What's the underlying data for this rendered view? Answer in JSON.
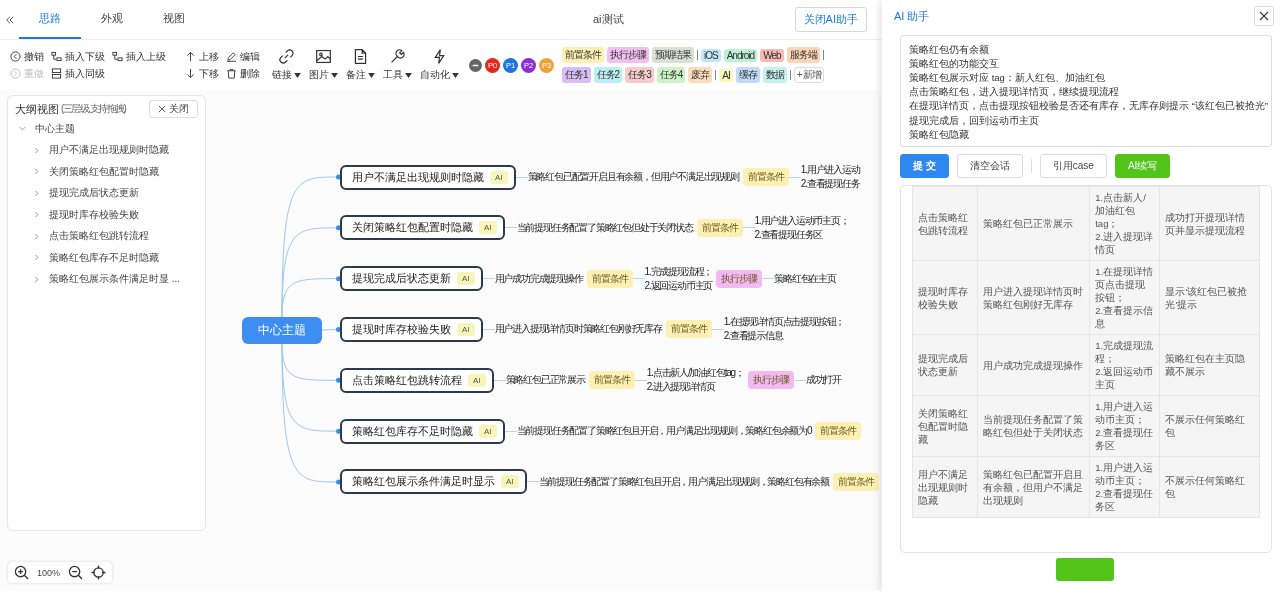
{
  "header": {
    "tabs": [
      {
        "label": "思路",
        "selected": true
      },
      {
        "label": "外观",
        "selected": false
      },
      {
        "label": "视图",
        "selected": false
      }
    ],
    "title": "ai测试",
    "toggle_button": "关闭AI助手"
  },
  "toolbar": {
    "edit_columns": [
      [
        {
          "label": "撤销",
          "kind": "undo",
          "disabled": false
        },
        {
          "label": "重做",
          "kind": "redo",
          "disabled": true
        }
      ],
      [
        {
          "label": "插入下级",
          "kind": "child",
          "disabled": false
        },
        {
          "label": "插入同级",
          "kind": "sibling",
          "disabled": false
        }
      ],
      [
        {
          "label": "插入上级",
          "kind": "parent",
          "disabled": false
        }
      ],
      [
        {
          "label": "上移",
          "kind": "up",
          "disabled": false
        },
        {
          "label": "下移",
          "kind": "down",
          "disabled": false
        }
      ],
      [
        {
          "label": "编辑",
          "kind": "edit",
          "disabled": false
        },
        {
          "label": "删除",
          "kind": "delete",
          "disabled": false
        }
      ]
    ],
    "menus": [
      {
        "label": "链接",
        "kind": "link"
      },
      {
        "label": "图片",
        "kind": "image"
      },
      {
        "label": "备注",
        "kind": "note"
      },
      {
        "label": "工具",
        "kind": "tool"
      },
      {
        "label": "自动化",
        "kind": "auto"
      }
    ],
    "priorities": [
      {
        "label": "P0",
        "color": "#e8261c"
      },
      {
        "label": "P1",
        "color": "#1f74e0"
      },
      {
        "label": "P2",
        "color": "#8a2fd8"
      },
      {
        "label": "P3",
        "color": "#f0a23a"
      }
    ],
    "tag_rows": [
      [
        [
          {
            "label": "前置条件",
            "color": "#fbf0b3"
          },
          {
            "label": "执行步骤",
            "color": "#f1c0f0"
          },
          {
            "label": "预期结果",
            "color": "#dcdfd3"
          }
        ],
        [
          {
            "label": "iOS",
            "color": "#c4e5f6"
          },
          {
            "label": "Android",
            "color": "#bdf0d4"
          },
          {
            "label": "Web",
            "color": "#f6bab4"
          },
          {
            "label": "服务端",
            "color": "#fbd6b6"
          }
        ]
      ],
      [
        [
          {
            "label": "任务1",
            "color": "#d9bdf6"
          },
          {
            "label": "任务2",
            "color": "#bdeef1"
          },
          {
            "label": "任务3",
            "color": "#f8cacb"
          },
          {
            "label": "任务4",
            "color": "#ccf3c5"
          },
          {
            "label": "废弃",
            "color": "#fbdcbc"
          }
        ],
        [
          {
            "label": "AI",
            "color": "#fbf8bb"
          },
          {
            "label": "缓存",
            "color": "#c1daf8"
          },
          {
            "label": "数据",
            "color": "#c3f1ef"
          }
        ]
      ]
    ],
    "add_tag": "+ 新增"
  },
  "outline": {
    "title": "大纲视图",
    "subtitle": "(三层级,支持拖拽)",
    "close": "关闭",
    "tree": [
      {
        "label": "中心主题",
        "expanded": true,
        "children": [
          {
            "label": "用户不满足出现规则时隐藏",
            "expanded": false
          },
          {
            "label": "关闭策略红包配置时隐藏",
            "expanded": false
          },
          {
            "label": "提现完成后状态更新",
            "expanded": false
          },
          {
            "label": "提现时库存校验失败",
            "expanded": false
          },
          {
            "label": "点击策略红包跳转流程",
            "expanded": false
          },
          {
            "label": "策略红包库存不足时隐藏",
            "expanded": false
          },
          {
            "label": "策略红包展示条件满足时显 ...",
            "expanded": false
          }
        ]
      }
    ]
  },
  "mindmap": {
    "center": "中心主题",
    "branches": [
      {
        "title": "用户不满足出现规则时隐藏",
        "ai_tag": {
          "label": "AI",
          "color": "#f5f6b8"
        },
        "condition": "策略红包已配置开启且有余额，但用户不满足出现规则",
        "condition_tag": {
          "label": "前置条件",
          "color": "#fcf0b2"
        },
        "steps": [
          "1.用户进入运动",
          "2.查看提现任务"
        ]
      },
      {
        "title": "关闭策略红包配置时隐藏",
        "ai_tag": {
          "label": "AI",
          "color": "#f5f6b8"
        },
        "condition": "当前提现任务配置了策略红包但处于关闭状态",
        "condition_tag": {
          "label": "前置条件",
          "color": "#fcf0b2"
        },
        "steps": [
          "1.用户进入运动币主页；",
          "2.查看提现任务区"
        ]
      },
      {
        "title": "提现完成后状态更新",
        "ai_tag": {
          "label": "AI",
          "color": "#f5f6b8"
        },
        "condition": "用户成功完成提现操作",
        "condition_tag": {
          "label": "前置条件",
          "color": "#fcf0b2"
        },
        "steps": [
          "1.完成提现流程；",
          "2.返回运动币主页"
        ],
        "steps_tag": {
          "label": "执行步骤",
          "color": "#f2b9f2"
        },
        "result": "策略红包在主页"
      },
      {
        "title": "提现时库存校验失败",
        "ai_tag": {
          "label": "AI",
          "color": "#f5f6b8"
        },
        "condition": "用户进入提现详情页时策略红包刚好无库存",
        "condition_tag": {
          "label": "前置条件",
          "color": "#fcf0b2"
        },
        "steps": [
          "1.在提现详情页点击提现按钮；",
          "2.查看提示信息"
        ]
      },
      {
        "title": "点击策略红包跳转流程",
        "ai_tag": {
          "label": "AI",
          "color": "#f5f6b8"
        },
        "condition": "策略红包已正常展示",
        "condition_tag": {
          "label": "前置条件",
          "color": "#fcf0b2"
        },
        "steps": [
          "1.点击新人/加油红包tag；",
          "2.进入提现详情页"
        ],
        "steps_tag": {
          "label": "执行步骤",
          "color": "#f2b9f2"
        },
        "result": "成功打开"
      },
      {
        "title": "策略红包库存不足时隐藏",
        "ai_tag": {
          "label": "AI",
          "color": "#f5f6b8"
        },
        "condition": "当前提现任务配置了策略红包且开启，用户满足出现规则，策略红包余额为0",
        "condition_tag": {
          "label": "前置条件",
          "color": "#fcf0b2"
        }
      },
      {
        "title": "策略红包展示条件满足时显示",
        "ai_tag": {
          "label": "AI",
          "color": "#f5f6b8"
        },
        "condition": "当前提现任务配置了策略红包且开启，用户满足出现规则，策略红包有余额",
        "condition_tag": {
          "label": "前置条件",
          "color": "#fcf0b2"
        }
      }
    ]
  },
  "zoom": {
    "value": "100%"
  },
  "ai_panel": {
    "title": "AI 助手",
    "prompt": {
      "value": [
        "策略红包仍有余额",
        "策略红包的功能交互",
        "策略红包展示对应 tag：新人红包、加油红包",
        "点击策略红包，进入提现详情页，继续提现流程",
        "在提现详情页，点击提现按钮校验是否还有库存，无库存则提示 “该红包已被抢光”",
        "提现完成后，回到运动币主页",
        "策略红包隐藏"
      ]
    },
    "buttons": [
      {
        "label": "提 交",
        "kind": "primary"
      },
      {
        "label": "清空会话",
        "kind": "default"
      },
      {
        "label": "引用case",
        "kind": "default"
      },
      {
        "label": "AI续写",
        "kind": "success"
      }
    ],
    "table": {
      "rows": [
        [
          "点击策略红包跳转流程",
          "策略红包已正常展示",
          [
            "1.点击新人/加油红包tag；",
            "2.进入提现详情页"
          ],
          "成功打开提现详情页并显示提现流程"
        ],
        [
          "提现时库存校验失败",
          "用户进入提现详情页时策略红包刚好无库存",
          [
            "1.在提现详情页点击提现按钮；",
            "2.查看提示信息"
          ],
          "显示'该红包已被抢光'提示"
        ],
        [
          "提现完成后状态更新",
          "用户成功完成提现操作",
          [
            "1.完成提现流程；",
            "2.返回运动币主页"
          ],
          "策略红包在主页隐藏不展示"
        ],
        [
          "关闭策略红包配置时隐藏",
          "当前提现任务配置了策略红包但处于关闭状态",
          [
            "1.用户进入运动币主页；",
            "2.查看提现任务区"
          ],
          "不展示任何策略红包"
        ],
        [
          "用户不满足出现规则时隐藏",
          "策略红包已配置开启且有余额，但用户不满足出现规则",
          [
            "1.用户进入运动币主页；",
            "2.查看提现任务区"
          ],
          "不展示任何策略红包"
        ]
      ]
    }
  }
}
